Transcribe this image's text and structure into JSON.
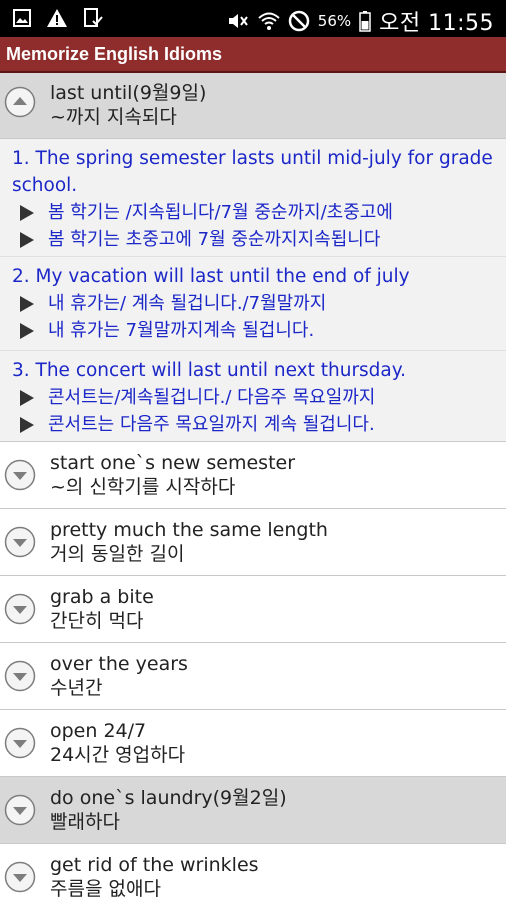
{
  "status_bar": {
    "battery_pct": "56%",
    "time": "오전 11:55",
    "icons": [
      "image-icon",
      "warning-icon",
      "tablet-check-icon",
      "mute-icon",
      "wifi-icon",
      "blocked-icon",
      "battery-icon"
    ]
  },
  "app": {
    "title": "Memorize English Idioms"
  },
  "expanded_item": {
    "en": "last until(9월9일)",
    "ko": "~까지 지속되다",
    "examples": [
      {
        "en": "1. The spring semester lasts until mid-july for grade school.",
        "ko": [
          "봄 학기는 /지속됩니다/7월 중순까지/초중고에",
          "봄 학기는 초중고에 7월 중순까지지속됩니다"
        ]
      },
      {
        "en": "2. My vacation will last until the end of july",
        "ko": [
          "내 휴가는/ 계속 될겁니다./7월말까지",
          "내 휴가는 7월말까지계속 될겁니다."
        ]
      },
      {
        "en": "3. The concert will last until next thursday.",
        "ko": [
          "콘서트는/계속될겁니다./ 다음주 목요일까지",
          "콘서트는 다음주 목요일까지 계속 될겁니다."
        ]
      }
    ]
  },
  "items": [
    {
      "en": "start one`s new semester",
      "ko": "~의 신학기를 시작하다",
      "gray": false
    },
    {
      "en": "pretty much the same length",
      "ko": "거의 동일한 길이",
      "gray": false
    },
    {
      "en": "grab a bite",
      "ko": "간단히 먹다",
      "gray": false
    },
    {
      "en": "over the years",
      "ko": "수년간",
      "gray": false
    },
    {
      "en": "open 24/7",
      "ko": "24시간 영업하다",
      "gray": false
    },
    {
      "en": "do one`s laundry(9월2일)",
      "ko": " 빨래하다",
      "gray": true
    },
    {
      "en": "get rid of the wrinkles",
      "ko": "주름을 없애다",
      "gray": false
    }
  ]
}
